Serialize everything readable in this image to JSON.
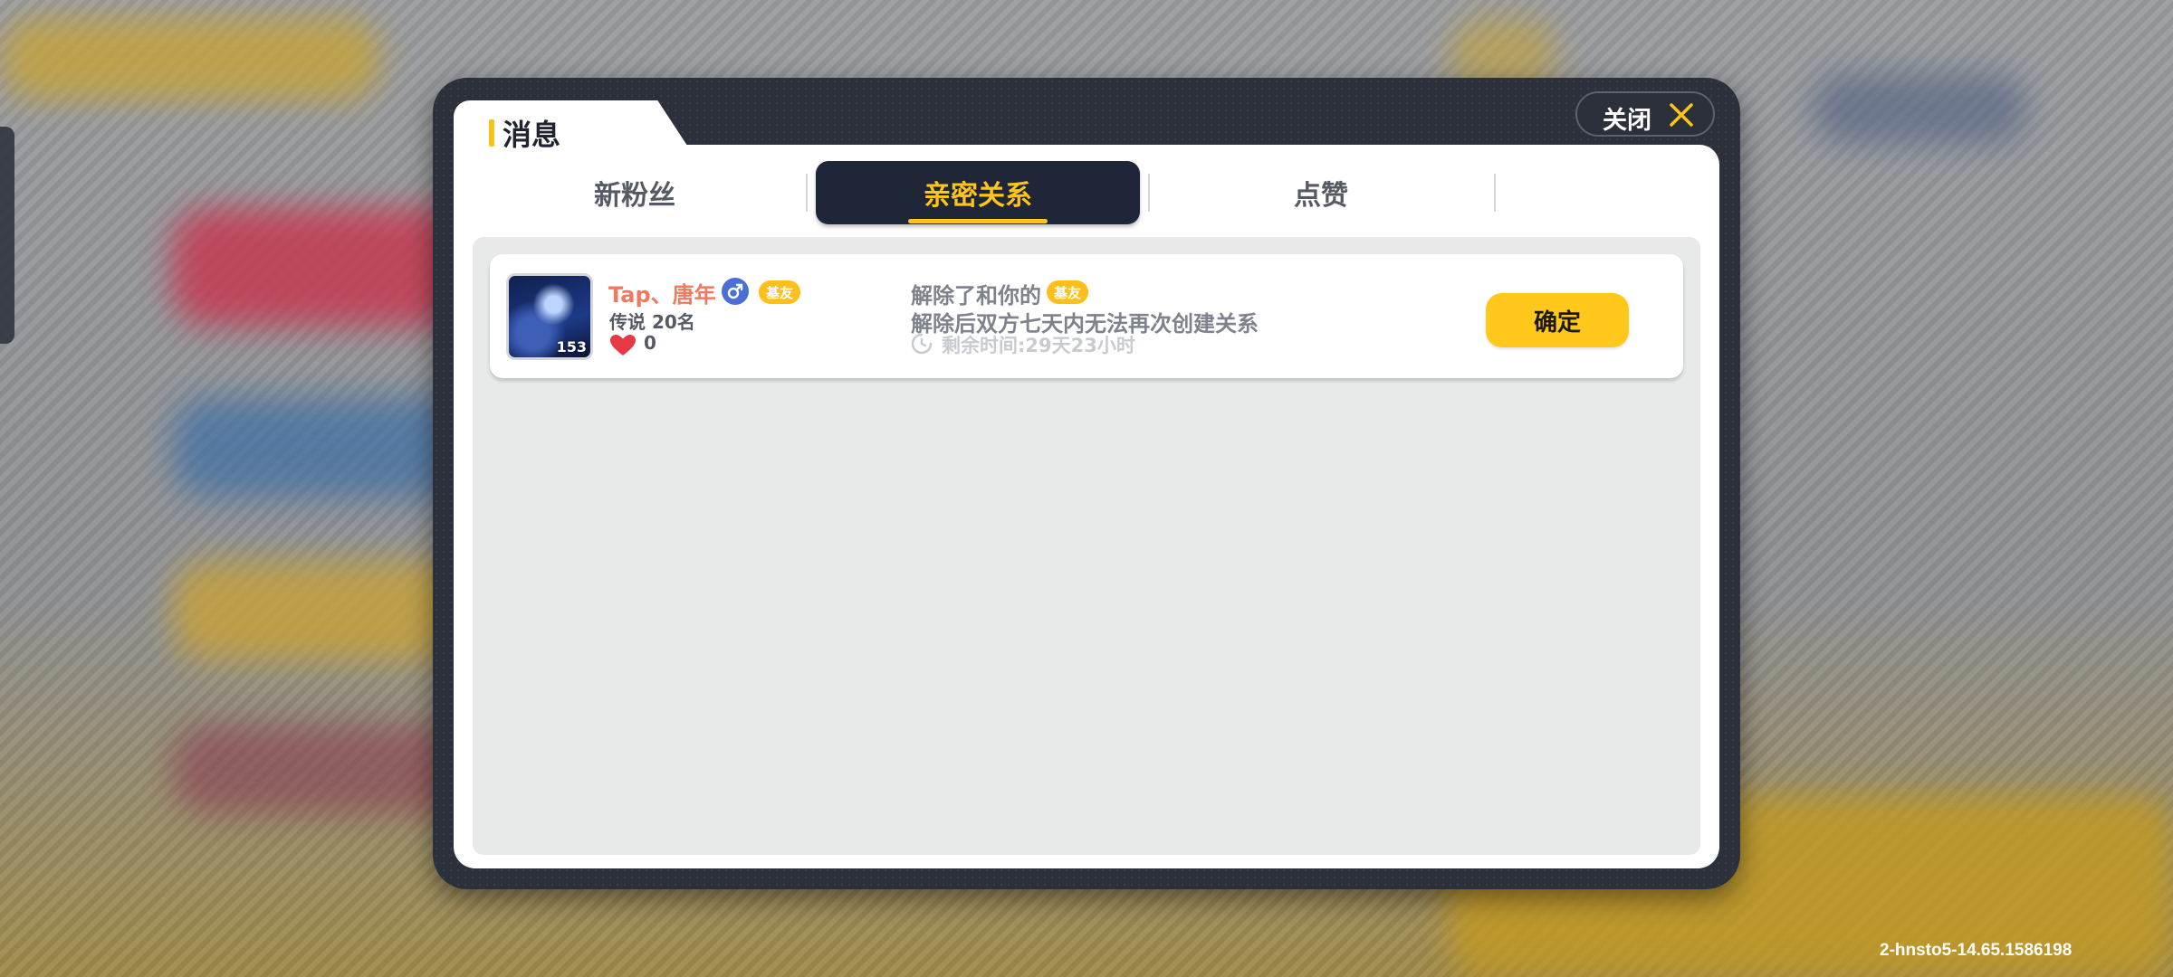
{
  "dialog": {
    "title": "消息",
    "close_label": "关闭"
  },
  "tabs": [
    {
      "label": "新粉丝",
      "active": false
    },
    {
      "label": "亲密关系",
      "active": true
    },
    {
      "label": "点赞",
      "active": false
    }
  ],
  "messages": [
    {
      "avatar_level": "153",
      "user_name": "Tap、唐年",
      "gender": "male",
      "relation_badge": "基友",
      "rank": "传说 20名",
      "likes": "0",
      "text_prefix": "解除了和你的",
      "text_badge": "基友",
      "text_line2": "解除后双方七天内无法再次创建关系",
      "remaining": "剩余时间:29天23小时",
      "confirm_label": "确定"
    }
  ],
  "footer": {
    "version": "2-hnsto5-14.65.1586198"
  },
  "colors": {
    "accent": "#ffc51a",
    "dialog_frame": "#2b303a",
    "active_tab": "#1f2638",
    "user_name": "#f07a5f",
    "gender_male": "#4b6fd8"
  }
}
